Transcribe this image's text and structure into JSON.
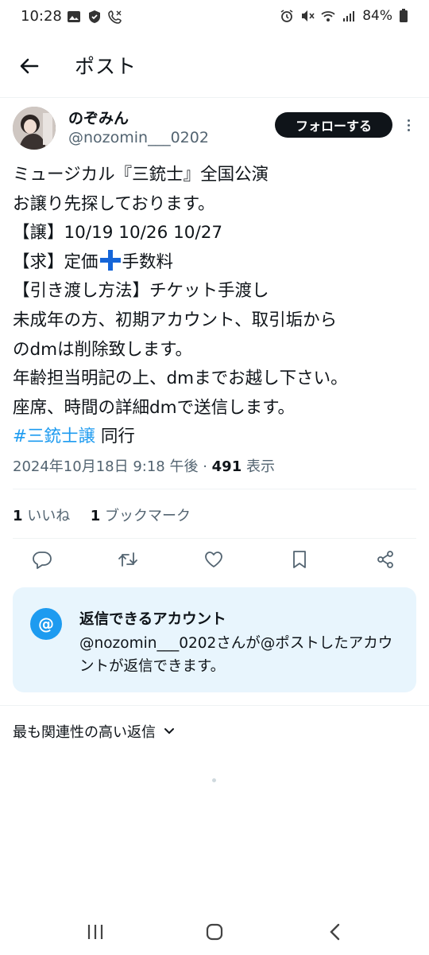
{
  "status_bar": {
    "time": "10:28",
    "battery": "84%",
    "icons": [
      "gallery-icon",
      "shield-icon",
      "call-icon",
      "alarm-icon",
      "mute-icon",
      "wifi-icon",
      "signal-icon",
      "battery-icon"
    ]
  },
  "header": {
    "title": "ポスト",
    "back_icon": "arrow-left-icon"
  },
  "author": {
    "display_name": "のぞみん",
    "handle": "@nozomin___0202",
    "follow_label": "フォローする"
  },
  "post": {
    "lines": [
      "ミュージカル『三銃士』全国公演",
      "お譲り先探しております。",
      "【譲】10/19 10/26 10/27",
      "【求】定価",
      "手数料",
      "【引き渡し方法】チケット手渡し",
      "未成年の方、初期アカウント、取引垢から",
      "のdmは削除致します。",
      "年齢担当明記の上、dmまでお越し下さい。",
      "座席、時間の詳細dmで送信します。"
    ],
    "hashtag": "#三銃士譲",
    "hashtag_suffix": " 同行",
    "timestamp": "2024年10月18日 9:18 午後",
    "separator": " · ",
    "views_count": "491",
    "views_label": " 表示"
  },
  "stats": {
    "likes_count": "1",
    "likes_label": " いいね",
    "bookmarks_count": "1",
    "bookmarks_label": " ブックマーク"
  },
  "actions": [
    "reply-icon",
    "retweet-icon",
    "like-icon",
    "bookmark-icon",
    "share-icon"
  ],
  "reply_notice": {
    "icon_text": "@",
    "title": "返信できるアカウント",
    "text": "@nozomin___0202さんが@ポストしたアカウントが返信できます。"
  },
  "sort": {
    "label": "最も関連性の高い返信"
  },
  "colors": {
    "accent": "#1d9bf0",
    "text": "#0f1419",
    "secondary": "#536471",
    "notice_bg": "#e8f5fd"
  }
}
